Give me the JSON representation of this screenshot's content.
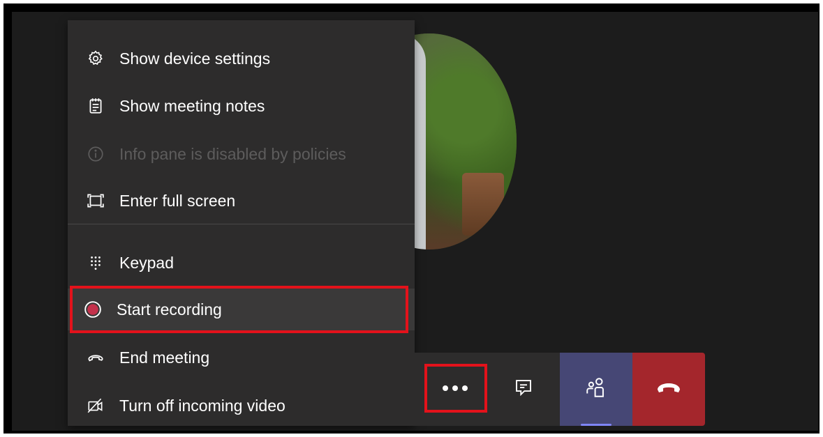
{
  "menu": {
    "items": [
      {
        "label": "Show device settings",
        "icon": "gear-icon"
      },
      {
        "label": "Show meeting notes",
        "icon": "notes-icon"
      },
      {
        "label": "Info pane is disabled by policies",
        "icon": "info-icon",
        "disabled": true
      },
      {
        "label": "Enter full screen",
        "icon": "fullscreen-icon"
      },
      {
        "label": "Keypad",
        "icon": "keypad-icon"
      },
      {
        "label": "Start recording",
        "icon": "record-icon",
        "highlighted": true
      },
      {
        "label": "End meeting",
        "icon": "end-meeting-icon"
      },
      {
        "label": "Turn off incoming video",
        "icon": "video-off-icon"
      }
    ]
  },
  "toolbar": {
    "buttons": [
      {
        "name": "more-actions",
        "icon": "ellipsis-icon",
        "highlighted": true
      },
      {
        "name": "chat",
        "icon": "chat-icon"
      },
      {
        "name": "participants",
        "icon": "people-icon"
      },
      {
        "name": "hang-up",
        "icon": "phone-hangup-icon"
      }
    ]
  },
  "colors": {
    "menu_bg": "#2d2c2c",
    "stage_bg": "#1c1c1c",
    "highlight_red": "#e3121b",
    "record_dot": "#c4314b",
    "participants_bg": "#464775",
    "hangup_bg": "#a4262c",
    "disabled_text": "#5d5c5c"
  }
}
